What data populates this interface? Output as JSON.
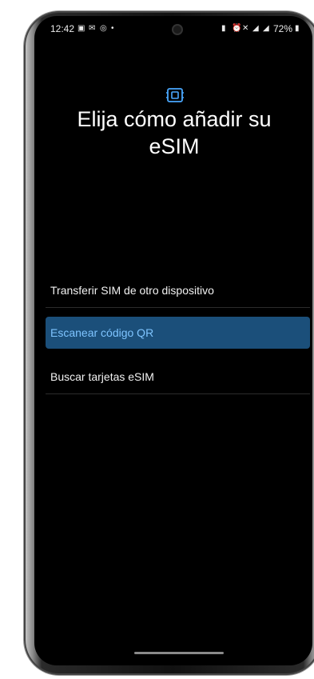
{
  "status_bar": {
    "time": "12:42",
    "battery": "72%"
  },
  "title": "Elija cómo añadir su eSIM",
  "options": [
    {
      "label": "Transferir SIM de otro dispositivo",
      "selected": false
    },
    {
      "label": "Escanear código QR",
      "selected": true
    },
    {
      "label": "Buscar tarjetas eSIM",
      "selected": false
    }
  ],
  "colors": {
    "accent": "#7ec4ff",
    "selected_bg": "#1b4f7a",
    "background": "#000000"
  },
  "icons": {
    "header": "esim-card-icon"
  }
}
